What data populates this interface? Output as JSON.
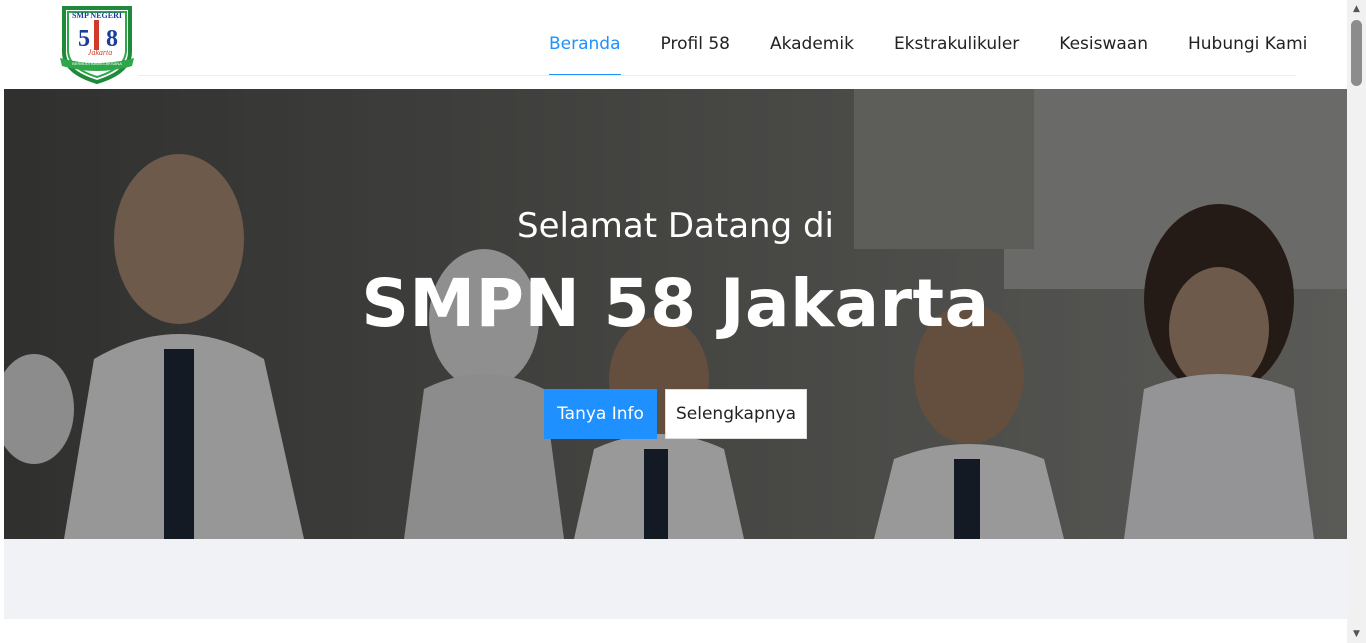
{
  "header": {
    "logo": {
      "top_text": "SMP NEGERI",
      "number_left": "5",
      "number_right": "8",
      "script_text": "Jakarta",
      "ribbon_text": "BERBUDI BAWA LAKSANA"
    },
    "nav": [
      {
        "label": "Beranda",
        "active": true
      },
      {
        "label": "Profil 58",
        "active": false
      },
      {
        "label": "Akademik",
        "active": false
      },
      {
        "label": "Ekstrakulikuler",
        "active": false
      },
      {
        "label": "Kesiswaan",
        "active": false
      },
      {
        "label": "Hubungi Kami",
        "active": false
      }
    ]
  },
  "hero": {
    "subtitle": "Selamat Datang di",
    "title": "SMPN 58 Jakarta",
    "primary_button": "Tanya Info",
    "secondary_button": "Selengkapnya"
  },
  "colors": {
    "accent": "#1e90ff",
    "band": "#f1f2f5"
  }
}
